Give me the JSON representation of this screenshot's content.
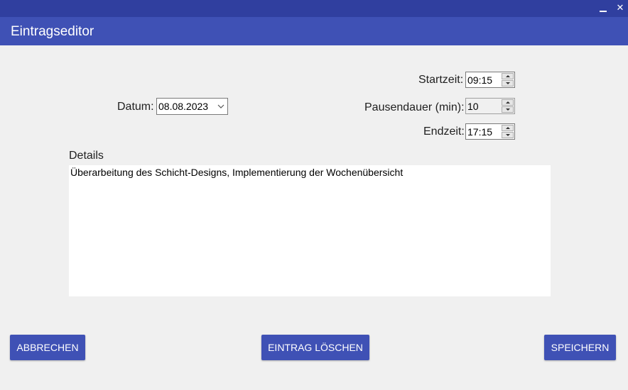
{
  "window": {
    "minimize_glyph": "",
    "close_glyph": "✕"
  },
  "header": {
    "title": "Eintragseditor"
  },
  "form": {
    "date_label": "Datum:",
    "date_value": "08.08.2023",
    "start_label": "Startzeit:",
    "start_value": "09:15",
    "pause_label": "Pausendauer (min):",
    "pause_value": "10",
    "end_label": "Endzeit:",
    "end_value": "17:15",
    "details_label": "Details",
    "details_value": "Überarbeitung des Schicht-Designs, Implementierung der Wochenübersicht"
  },
  "buttons": {
    "cancel": "ABBRECHEN",
    "delete": "EINTRAG LÖSCHEN",
    "save": "SPEICHERN"
  },
  "colors": {
    "titlebar": "#303f9f",
    "header": "#3f51b5",
    "button": "#3f51b5",
    "background": "#f0f0f0"
  },
  "icons": [
    "minimize-icon",
    "close-icon",
    "chevron-down-icon",
    "spin-up-icon",
    "spin-down-icon"
  ]
}
